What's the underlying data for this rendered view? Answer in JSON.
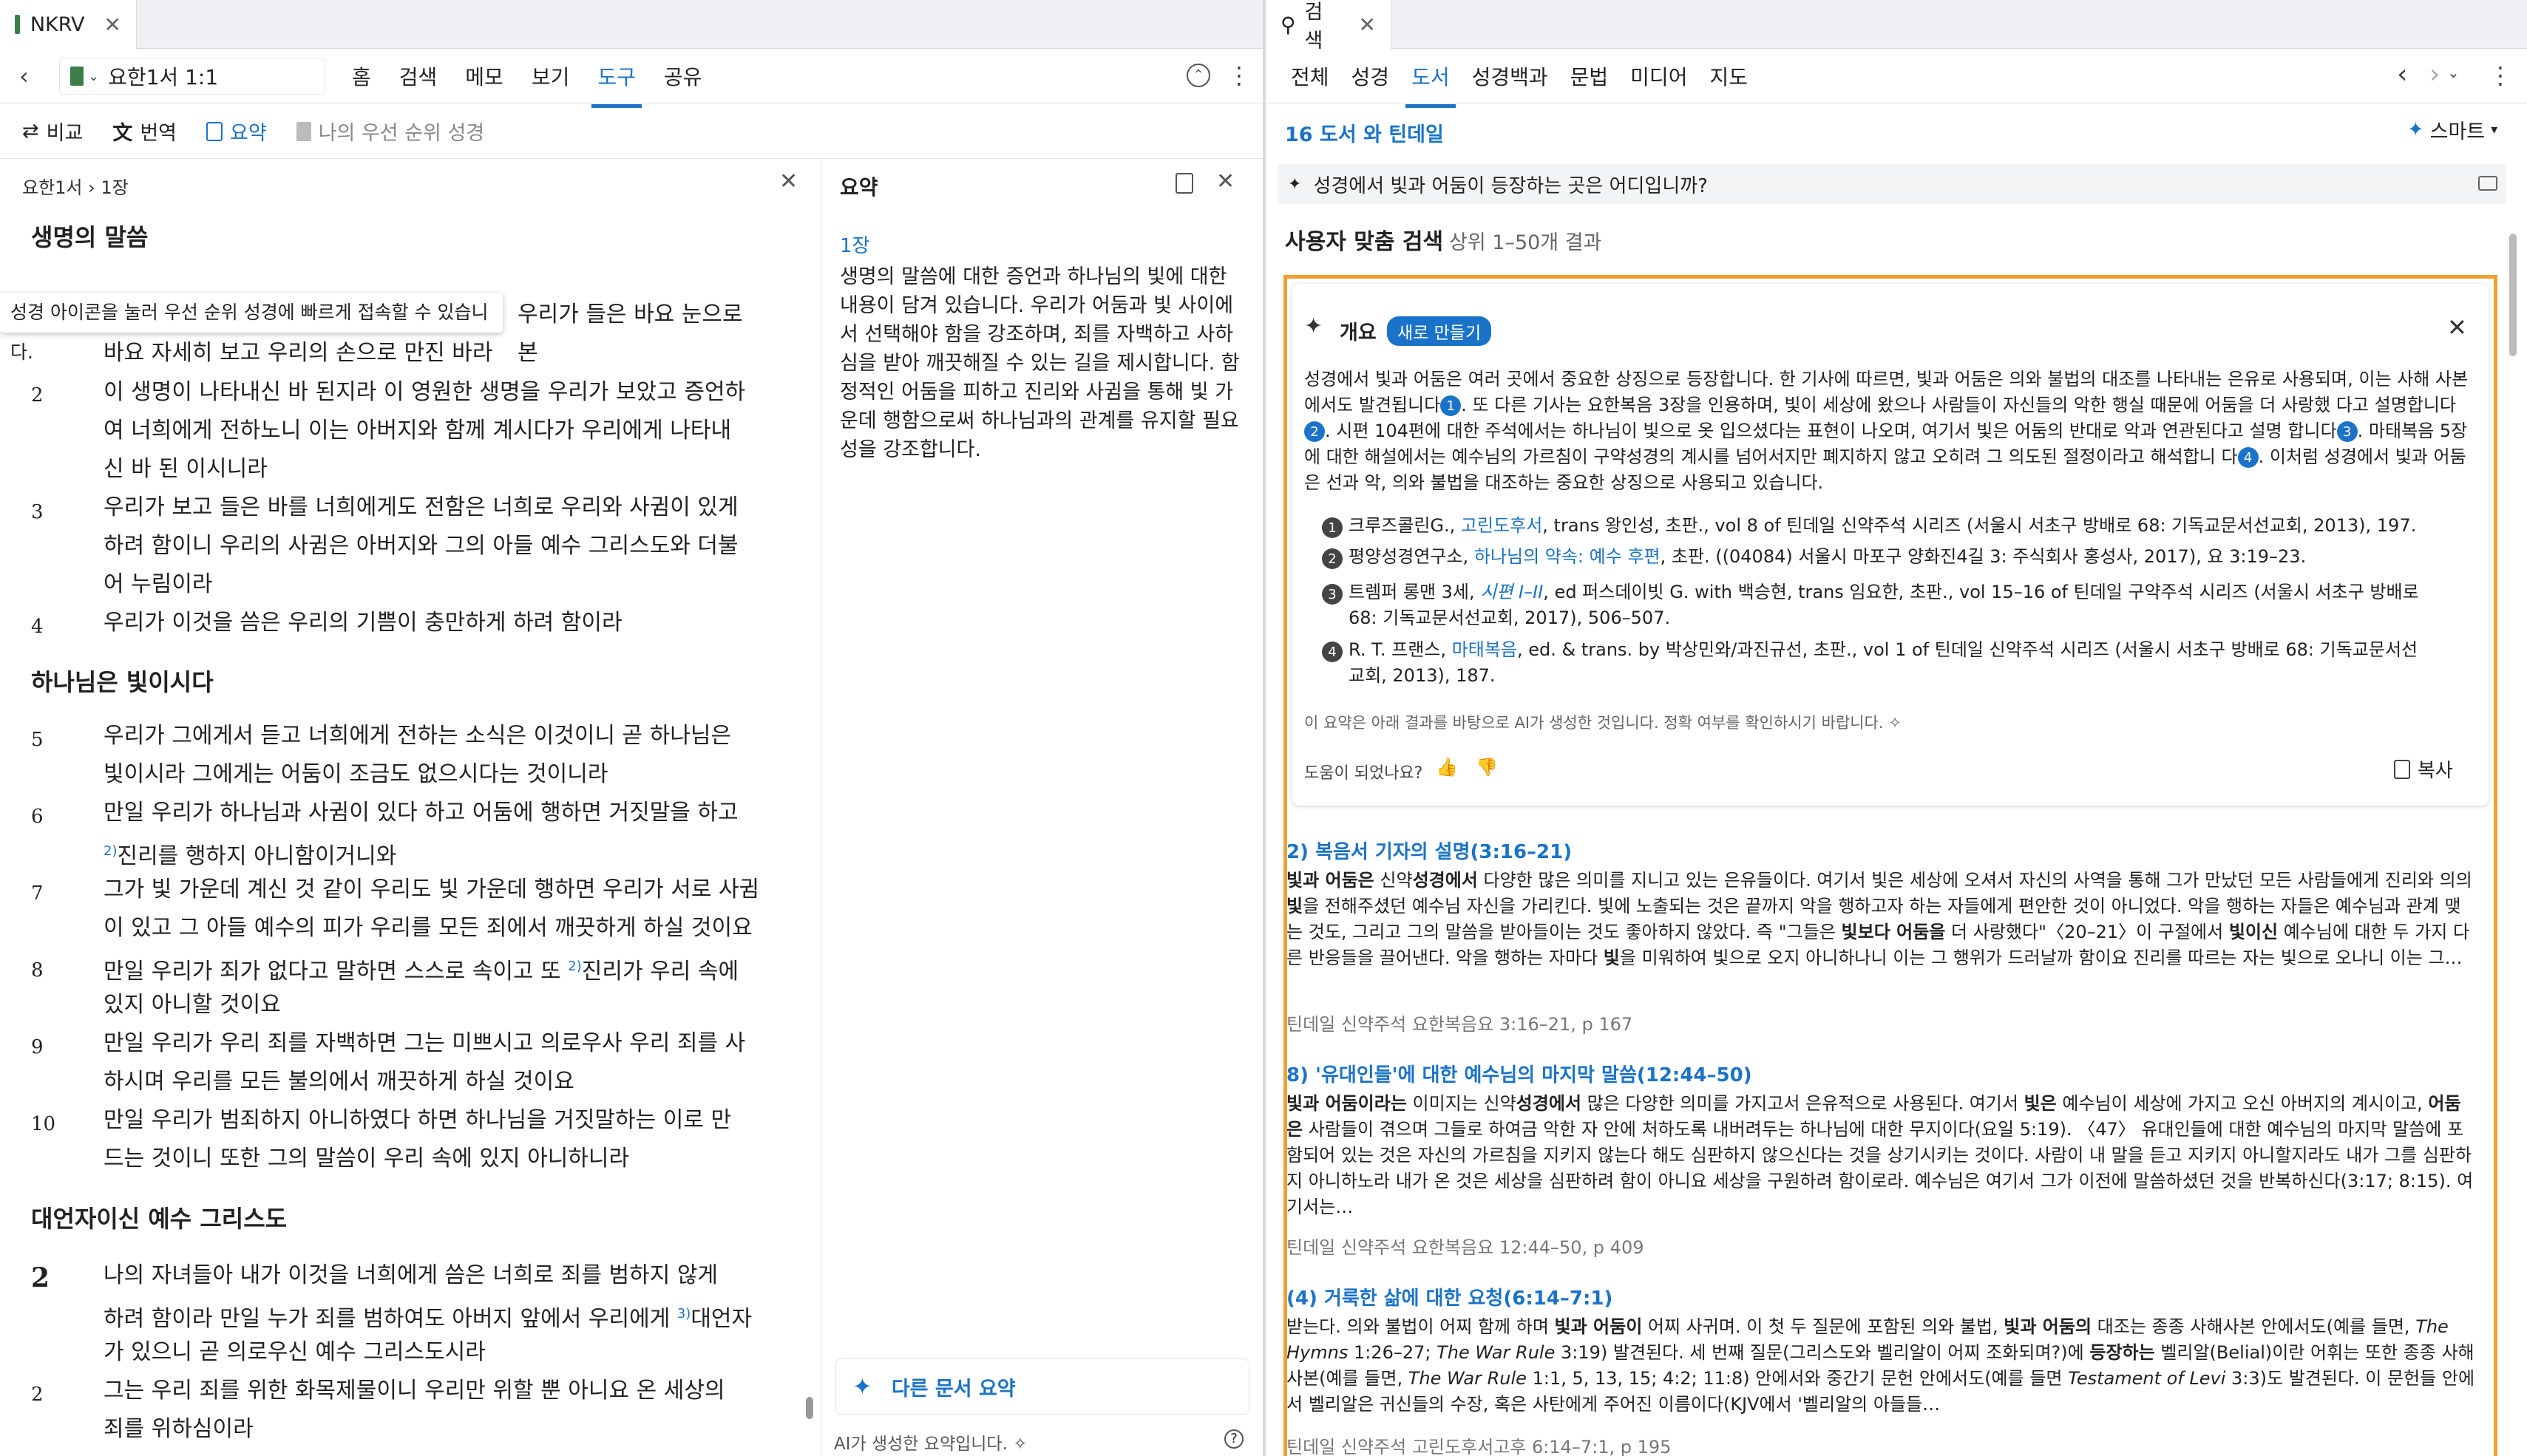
{
  "left": {
    "tab_title": "NKRV",
    "reference": "요한1서 1:1",
    "menu": [
      "홈",
      "검색",
      "메모",
      "보기",
      "도구",
      "공유"
    ],
    "active_menu": "도구",
    "tools": {
      "compare": "비교",
      "translate": "번역",
      "summary": "요약",
      "priority": "나의 우선 순위 성경"
    },
    "breadcrumb": "요한1서 › 1장",
    "tooltip": "성경 아이콘을 눌러 우선 순위 성경에 빠르게 접속할 수 있습니다.",
    "sections": {
      "s1": "생명의 말씀",
      "s2": "하나님은 빛이시다",
      "s3": "대언자이신 예수 그리스도"
    },
    "verses": [
      {
        "n": "",
        "l1": "우리가 들은 바요 눈으로 본",
        "l2": "바요 자세히 보고 우리의 손으로 만진 바라"
      },
      {
        "n": "2",
        "l1": "이 생명이 나타내신 바 된지라 이 영원한 생명을 우리가 보았고 증언하",
        "l2": "여 너희에게 전하노니 이는 아버지와 함께 계시다가 우리에게 나타내",
        "l3": "신 바 된 이시니라"
      },
      {
        "n": "3",
        "l1": "우리가 보고 들은 바를 너희에게도 전함은 너희로 우리와 사귐이 있게",
        "l2": "하려 함이니 우리의 사귐은 아버지와 그의 아들 예수 그리스도와 더불",
        "l3": "어 누림이라"
      },
      {
        "n": "4",
        "l1": "우리가 이것을 씀은 우리의 기쁨이 충만하게 하려 함이라"
      },
      {
        "n": "5",
        "l1": "우리가 그에게서 듣고 너희에게 전하는 소식은 이것이니 곧 하나님은",
        "l2": "빛이시라 그에게는 어둠이 조금도 없으시다는 것이니라"
      },
      {
        "n": "6",
        "l1": "만일 우리가 하나님과 사귐이 있다 하고 어둠에 행하면 거짓말을 하고",
        "sup": "2)",
        "l2": "진리를 행하지 아니함이거니와"
      },
      {
        "n": "7",
        "l1": "그가 빛 가운데 계신 것 같이 우리도 빛 가운데 행하면 우리가 서로 사귐",
        "l2": "이 있고 그 아들 예수의 피가 우리를 모든 죄에서 깨끗하게 하실 것이요"
      },
      {
        "n": "8",
        "l1a": "만일 우리가 죄가 없다고 말하면 스스로 속이고 또 ",
        "sup": "2)",
        "l1b": "진리가 우리 속에",
        "l2": "있지 아니할 것이요"
      },
      {
        "n": "9",
        "l1": "만일 우리가 우리 죄를 자백하면 그는 미쁘시고 의로우사 우리 죄를 사",
        "l2": "하시며 우리를 모든 불의에서 깨끗하게 하실 것이요"
      },
      {
        "n": "10",
        "l1": "만일 우리가 범죄하지 아니하였다 하면 하나님을 거짓말하는 이로 만",
        "l2": "드는 것이니 또한 그의 말씀이 우리 속에 있지 아니하니라"
      },
      {
        "n": "2",
        "l1": "나의 자녀들아 내가 이것을 너희에게 씀은 너희로 죄를 범하지 않게",
        "l2a": "하려 함이라 만일 누가 죄를 범하여도 아버지 앞에서 우리에게 ",
        "sup": "3)",
        "l2b": "대언자",
        "l3": "가 있으니 곧 의로우신 예수 그리스도시라"
      },
      {
        "n": "2",
        "l1": "그는 우리 죄를 위한 화목제물이니 우리만 위할 뿐 아니요 온 세상의",
        "l2": "죄를 위하심이라"
      }
    ],
    "summary_panel": {
      "title": "요약",
      "chapter": "1장",
      "text": "생명의 말씀에 대한 증언과 하나님의 빛에 대한 내용이 담겨 있습니다. 우리가 어둠과 빛 사이에서 선택해야 함을 강조하며, 죄를 자백하고 사하심을 받아 깨끗해질 수 있는 길을 제시합니다. 함정적인 어둠을 피하고 진리와 사귐을 통해 빛 가운데 행함으로써 하나님과의 관계를 유지할 필요성을 강조합니다.",
      "other_doc": "다른 문서 요약",
      "footer": "AI가 생성한 요약입니다."
    }
  },
  "right": {
    "tab_title": "검색",
    "menu": [
      "전체",
      "성경",
      "도서",
      "성경백과",
      "문법",
      "미디어",
      "지도"
    ],
    "active_menu": "도서",
    "result_count": "16 도서 와 틴데일",
    "smart": "스마트",
    "query": "성경에서 빛과 어둠이 등장하는 곳은 어디입니까?",
    "custom_title": "사용자 맞춤 검색",
    "custom_sub": "상위 1–50개 결과",
    "overview": {
      "title": "개요",
      "badge": "새로 만들기",
      "p1": "성경에서 빛과 어둠은 여러 곳에서 중요한 상징으로 등장합니다. 한 기사에 따르면, 빛과 어둠은 의와 불법의 대조를 나타내는 은유로 사용되며, 이는",
      "p2": "사해 사본에서도 발견됩니다",
      "p3": ". 또 다른 기사는 요한복음 3장을 인용하며, 빛이 세상에 왔으나 사람들이 자신들의 악한 행실 때문에 어둠을 더 사랑했",
      "p4": "다고 설명합니다",
      "p5": ". 시편 104편에 대한 주석에서는 하나님이 빛으로 옷 입으셨다는 표현이 나오며, 여기서 빛은 어둠의 반대로 악과 연관된다고 설명",
      "p6": "합니다",
      "p7": ". 마태복음 5장에 대한 해설에서는 예수님의 가르침이 구약성경의 계시를 넘어서지만 폐지하지 않고 오히려 그 의도된 절정이라고 해석합니",
      "p8": "다",
      "p9": ". 이처럼 성경에서 빛과 어둠은 선과 악, 의와 불법을 대조하는 중요한 상징으로 사용되고 있습니다.",
      "refs": [
        {
          "n": "1",
          "a": "크루즈콜린G., ",
          "link": "고린도후서",
          "b": ", trans 왕인성, 초판., vol 8 of 틴데일 신약주석 시리즈 (서울시 서초구 방배로 68: 기독교문서선교회, 2013), 197."
        },
        {
          "n": "2",
          "a": "평양성경연구소, ",
          "link": "하나님의 약속: 예수 후편",
          "b": ", 초판. ((04084) 서울시 마포구 양화진4길 3: 주식회사 홍성사, 2017), 요 3:19–23."
        },
        {
          "n": "3",
          "a": "트렘퍼 롱맨 3세, ",
          "link": "시편 I–II",
          "b": ", ed 퍼스데이빗 G. with 백승현, trans 임요한, 초판., vol 15–16 of 틴데일 구약주석 시리즈 (서울시 서초구 방배로",
          "c": "68: 기독교문서선교회, 2017), 506–507."
        },
        {
          "n": "4",
          "a": "R. T. 프랜스, ",
          "link": "마태복음",
          "b": ", ed. & trans. by 박상민와/과진규선, 초판., vol 1 of 틴데일 신약주석 시리즈 (서울시 서초구 방배로 68: 기독교문서선",
          "c": "교회, 2013), 187."
        }
      ],
      "disclaimer": "이 요약은 아래 결과를 바탕으로 AI가 생성한 것입니다. 정확 여부를 확인하시기 바랍니다.",
      "helpful": "도움이 되었나요?",
      "copy": "복사"
    },
    "results": [
      {
        "title": "2) 복음서 기자의 설명(3:16–21)",
        "source": "틴데일 신약주석 요한복음요 3:16–21, p 167"
      },
      {
        "title": "8) '유대인들'에 대한 예수님의 마지막 말씀(12:44–50)",
        "source": "틴데일 신약주석 요한복음요 12:44–50, p 409"
      },
      {
        "title": "(4) 거룩한 삶에 대한 요청(6:14–7:1)",
        "source": "틴데일 신약주석 고린도후서고후 6:14–7:1, p 195"
      }
    ]
  },
  "colors": {
    "accent": "#1a73c8",
    "highlight": "#f0a030"
  }
}
